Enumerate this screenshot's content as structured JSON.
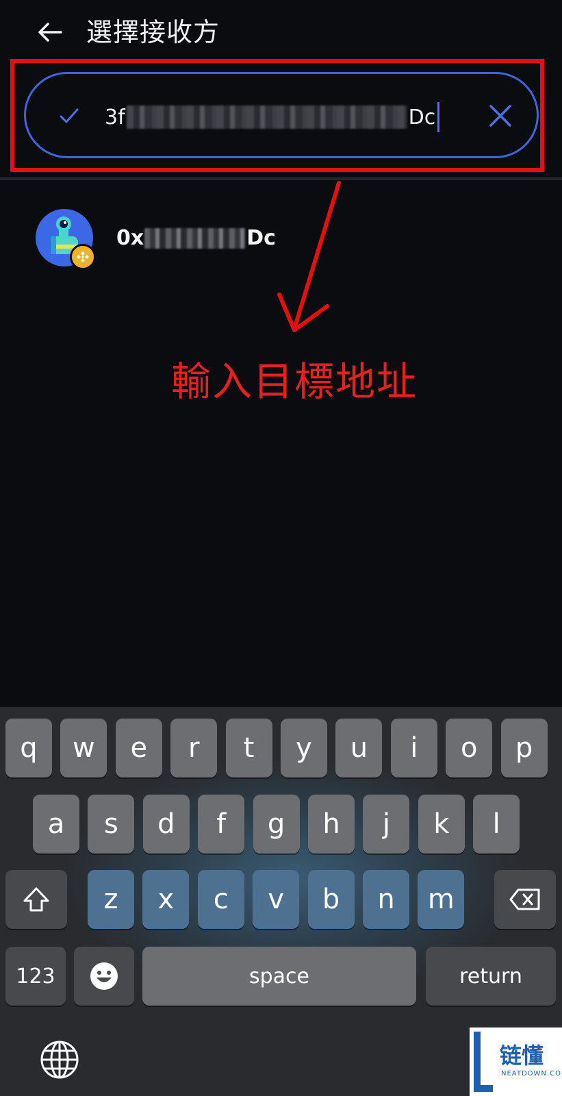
{
  "header": {
    "back_icon": "arrow-left-icon",
    "title": "選擇接收方"
  },
  "search": {
    "value_prefix": "3f",
    "value_suffix": "Dc",
    "check_icon": "check-icon",
    "clear_icon": "close-icon",
    "accent_color": "#3f65d8"
  },
  "result": {
    "address_prefix": "0x",
    "address_suffix": "Dc",
    "badge_icon": "bnb-chain-icon"
  },
  "annotation": {
    "text": "輸入目標地址",
    "color": "#e40f0f"
  },
  "keyboard": {
    "row1": [
      "q",
      "w",
      "e",
      "r",
      "t",
      "y",
      "u",
      "i",
      "o",
      "p"
    ],
    "row2": [
      "a",
      "s",
      "d",
      "f",
      "g",
      "h",
      "j",
      "k",
      "l"
    ],
    "row3": [
      "z",
      "x",
      "c",
      "v",
      "b",
      "n",
      "m"
    ],
    "numbers_label": "123",
    "space_label": "space",
    "return_label": "return",
    "shift_icon": "shift-icon",
    "delete_icon": "backspace-icon",
    "emoji_icon": "emoji-icon",
    "globe_icon": "globe-icon"
  },
  "watermark": {
    "text": "链懂",
    "sub": "NEATDOWN.COM"
  }
}
